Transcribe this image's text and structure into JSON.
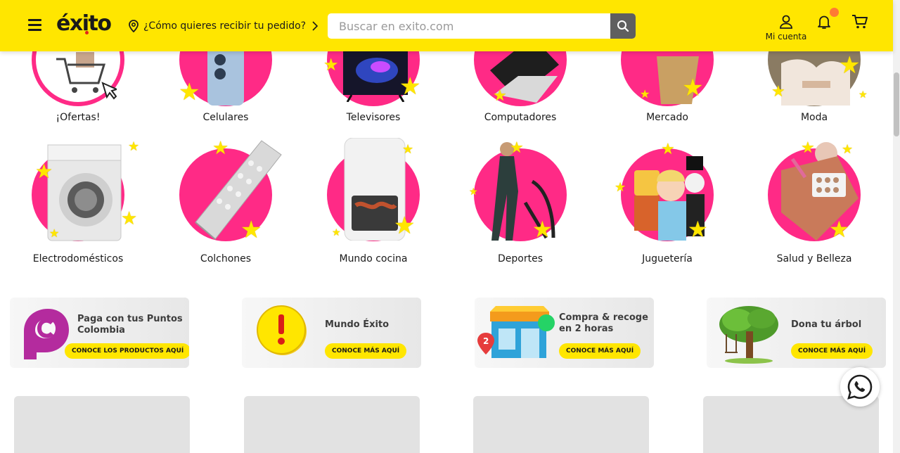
{
  "header": {
    "logo": "éxito",
    "delivery_prompt": "¿Cómo quieres recibir tu pedido?",
    "search_placeholder": "Buscar en exito.com",
    "account_label": "Mi cuenta",
    "brand_color": "#ffe600",
    "notification_badge_color": "#ff7a33"
  },
  "categories_row1": [
    {
      "label": "¡Ofertas!",
      "icon": "shopping-cart-offers"
    },
    {
      "label": "Celulares",
      "icon": "smartphone"
    },
    {
      "label": "Televisores",
      "icon": "television"
    },
    {
      "label": "Computadores",
      "icon": "laptop"
    },
    {
      "label": "Mercado",
      "icon": "grocery-bag"
    },
    {
      "label": "Moda",
      "icon": "fashion-person"
    }
  ],
  "categories_row2": [
    {
      "label": "Electrodomésticos",
      "icon": "washing-machine"
    },
    {
      "label": "Colchones",
      "icon": "mattress"
    },
    {
      "label": "Mundo cocina",
      "icon": "air-fryer"
    },
    {
      "label": "Deportes",
      "icon": "elliptical-trainer"
    },
    {
      "label": "Juguetería",
      "icon": "toys"
    },
    {
      "label": "Salud y Belleza",
      "icon": "makeup-bag"
    }
  ],
  "category_circle_color": "#ff2a86",
  "banners": [
    {
      "title": "Paga con tus Puntos Colombia",
      "cta": "CONOCE LOS PRODUCTOS AQUÍ",
      "icon": "puntos-colombia-logo"
    },
    {
      "title": "Mundo Éxito",
      "cta": "CONOCE MÁS AQUÍ",
      "icon": "exclamation-coin"
    },
    {
      "title": "Compra & recoge en 2 horas",
      "cta": "CONOCE MÁS AQUÍ",
      "icon": "store-pickup"
    },
    {
      "title": "Dona tu árbol",
      "cta": "CONOCE MÁS AQUÍ",
      "icon": "tree"
    }
  ],
  "whatsapp_icon": "whatsapp-icon"
}
